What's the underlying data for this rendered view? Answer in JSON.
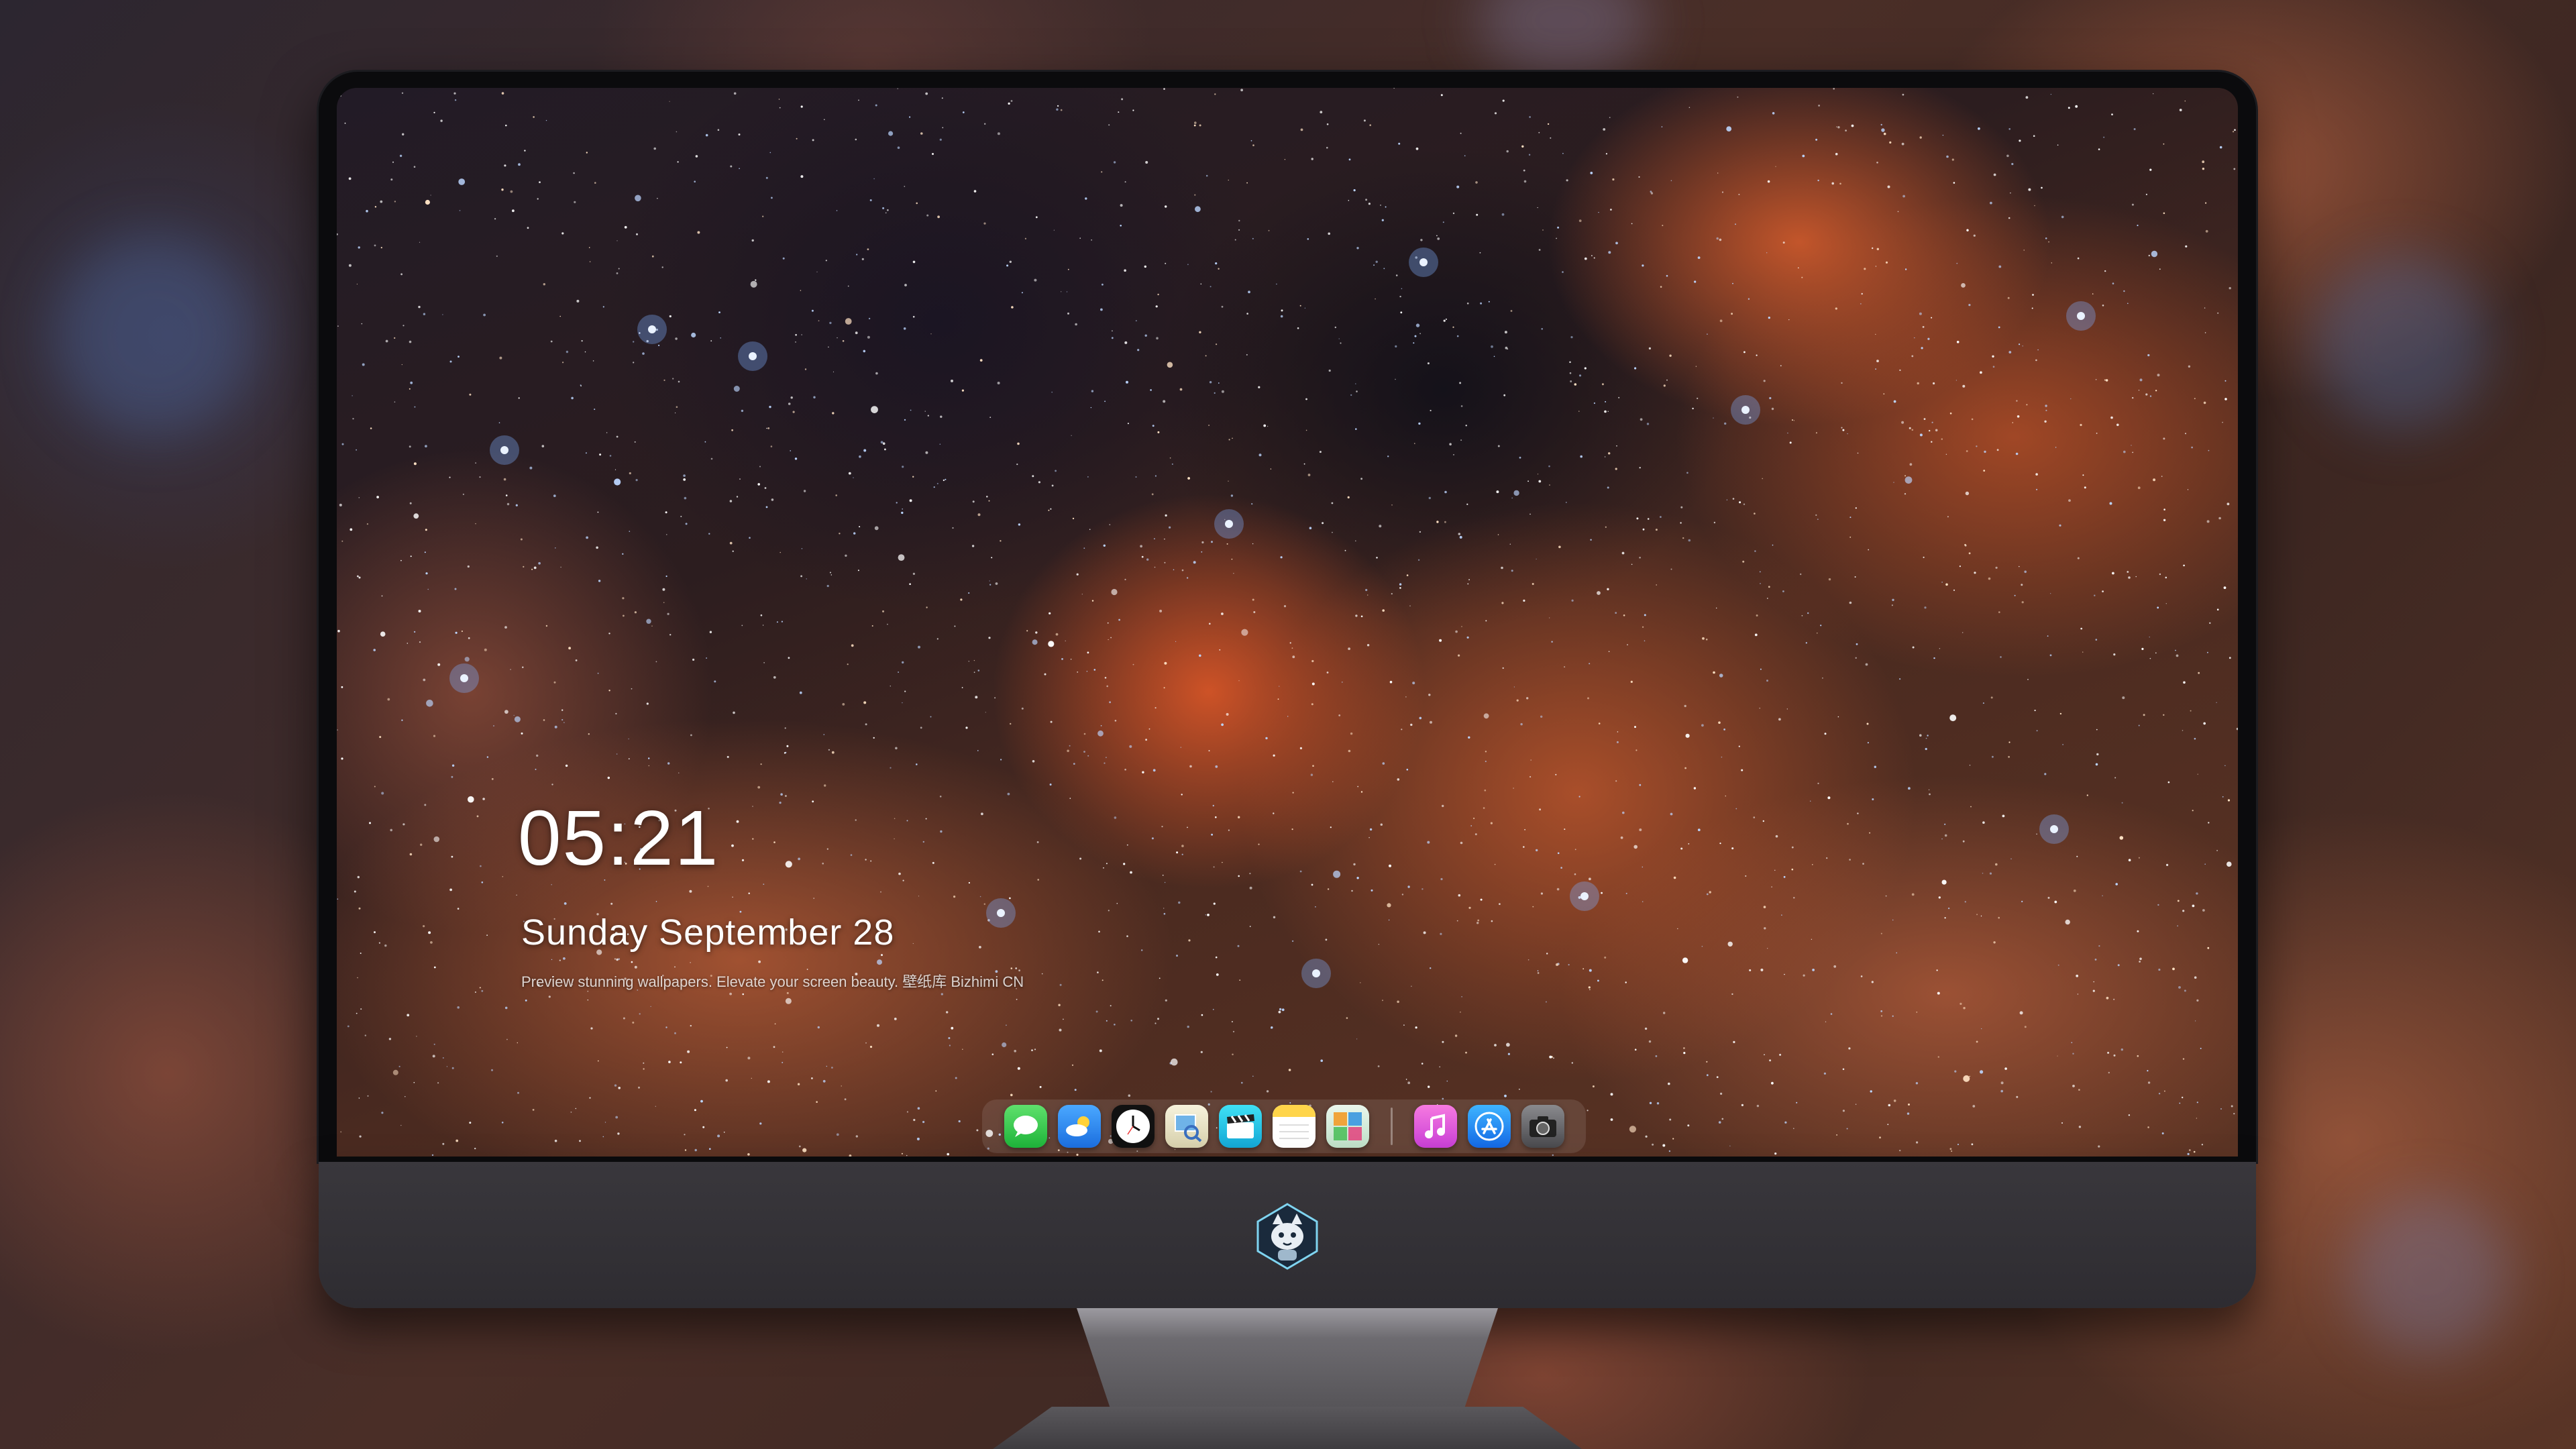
{
  "lock_screen": {
    "time": "05:21",
    "date": "Sunday September  28",
    "caption": "Preview stunning wallpapers. Elevate your screen beauty. 壁纸库 Bizhimi CN"
  },
  "dock": {
    "apps": [
      {
        "name": "Messages",
        "icon": "messages-icon",
        "color": "#36c24a"
      },
      {
        "name": "Weather",
        "icon": "weather-icon",
        "color": "#2d8cf0"
      },
      {
        "name": "Clock",
        "icon": "clock-icon",
        "color": "#1a1a1a"
      },
      {
        "name": "Preview",
        "icon": "preview-icon",
        "color": "#e8e3c8"
      },
      {
        "name": "Clips",
        "icon": "clips-icon",
        "color": "#1fc6e6"
      },
      {
        "name": "Notes",
        "icon": "notes-icon",
        "color": "#ffd54a"
      },
      {
        "name": "Photo Booth",
        "icon": "photo-booth-icon",
        "color": "#d9efe0"
      },
      {
        "name": "iTunes",
        "icon": "itunes-icon",
        "color": "#e24fd6"
      },
      {
        "name": "App Store",
        "icon": "app-store-icon",
        "color": "#1e8ff5"
      },
      {
        "name": "Camera",
        "icon": "camera-icon",
        "color": "#3a3a3c"
      }
    ]
  },
  "monitor": {
    "logo_icon": "fox-mascot-logo-icon"
  }
}
